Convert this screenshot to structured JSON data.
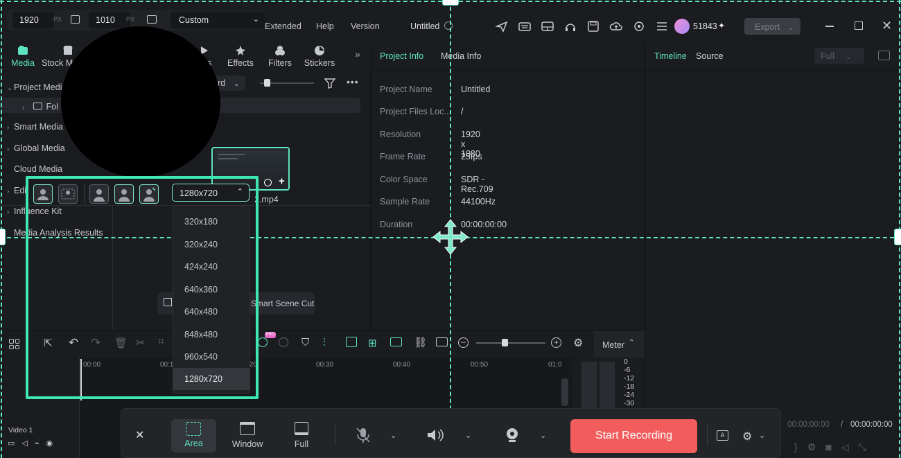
{
  "recorder": {
    "width_value": "1920",
    "height_value": "1010",
    "px_unit": "PX",
    "preset": "Custom",
    "resolution_selected": "1280x720",
    "resolution_options": [
      "320x180",
      "320x240",
      "424x240",
      "640x360",
      "640x480",
      "848x480",
      "960x540",
      "1280x720"
    ],
    "modes": {
      "area": "Area",
      "window": "Window",
      "full": "Full"
    },
    "start_label": "Start Recording",
    "accent": "#5de4c0",
    "start_color": "#f25c5c"
  },
  "menu": {
    "extended": "Extended",
    "help": "Help",
    "version": "Version",
    "project_title": "Untitled",
    "user_id": "51843",
    "export_label": "Export"
  },
  "media_tabs": {
    "media": "Media",
    "stock": "Stock M",
    "transitions": "ons",
    "effects": "Effects",
    "filters": "Filters",
    "stickers": "Stickers"
  },
  "media_panel": {
    "sort_value": "rd",
    "tree": {
      "project_media": "Project Media",
      "folder": "Fol",
      "smart_media": "Smart Media",
      "global_media": "Global Media",
      "cloud_media": "Cloud Media",
      "edit": "Edi",
      "influence_kit": "Influence Kit",
      "analysis": "Media Analysis Results"
    },
    "clip_name": "2.mp4",
    "scene_cut": "Smart Scene Cut"
  },
  "info_panel": {
    "tabs": [
      "Project Info",
      "Media Info"
    ],
    "rows": [
      {
        "label": "Project Name",
        "value": "Untitled"
      },
      {
        "label": "Project Files Loc...",
        "value": "/"
      },
      {
        "label": "Resolution",
        "value": "1920 x 1080"
      },
      {
        "label": "Frame Rate",
        "value": "25fps"
      },
      {
        "label": "Color Space",
        "value": "SDR - Rec.709"
      },
      {
        "label": "Sample Rate",
        "value": "44100Hz"
      },
      {
        "label": "Duration",
        "value": "00:00:00:00"
      }
    ]
  },
  "player": {
    "tabs": [
      "Timeline",
      "Source"
    ],
    "quality": "Full",
    "time_current": "00:00:00:00",
    "time_sep": "/",
    "time_total": "00:00:00:00"
  },
  "timeline": {
    "ticks": [
      "00:00",
      "00:1",
      ":20",
      "00:30",
      "00:40",
      "00:50",
      "01:0"
    ],
    "meter_label": "Meter",
    "meter_scale": [
      "0",
      "-6",
      "-12",
      "-18",
      "-24",
      "-30"
    ],
    "track_label": "Video 1",
    "badge": "PRO"
  }
}
